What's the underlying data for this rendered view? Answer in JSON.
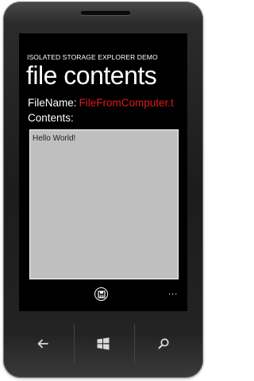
{
  "app": {
    "app_title": "ISOLATED STORAGE EXPLORER DEMO",
    "page_title": "file contents"
  },
  "file": {
    "name_label": "FileName:",
    "name_value": "FileFromComputer.t",
    "contents_label": "Contents:",
    "contents_text": "Hello World!"
  },
  "app_bar": {
    "save_icon": "save-icon",
    "more_label": "..."
  },
  "hardware_buttons": {
    "back": "back-arrow-icon",
    "start": "windows-logo-icon",
    "search": "search-icon"
  },
  "colors": {
    "accent": "#e01818",
    "screen_background": "#000000",
    "textbox_background": "#bfbfbf"
  }
}
